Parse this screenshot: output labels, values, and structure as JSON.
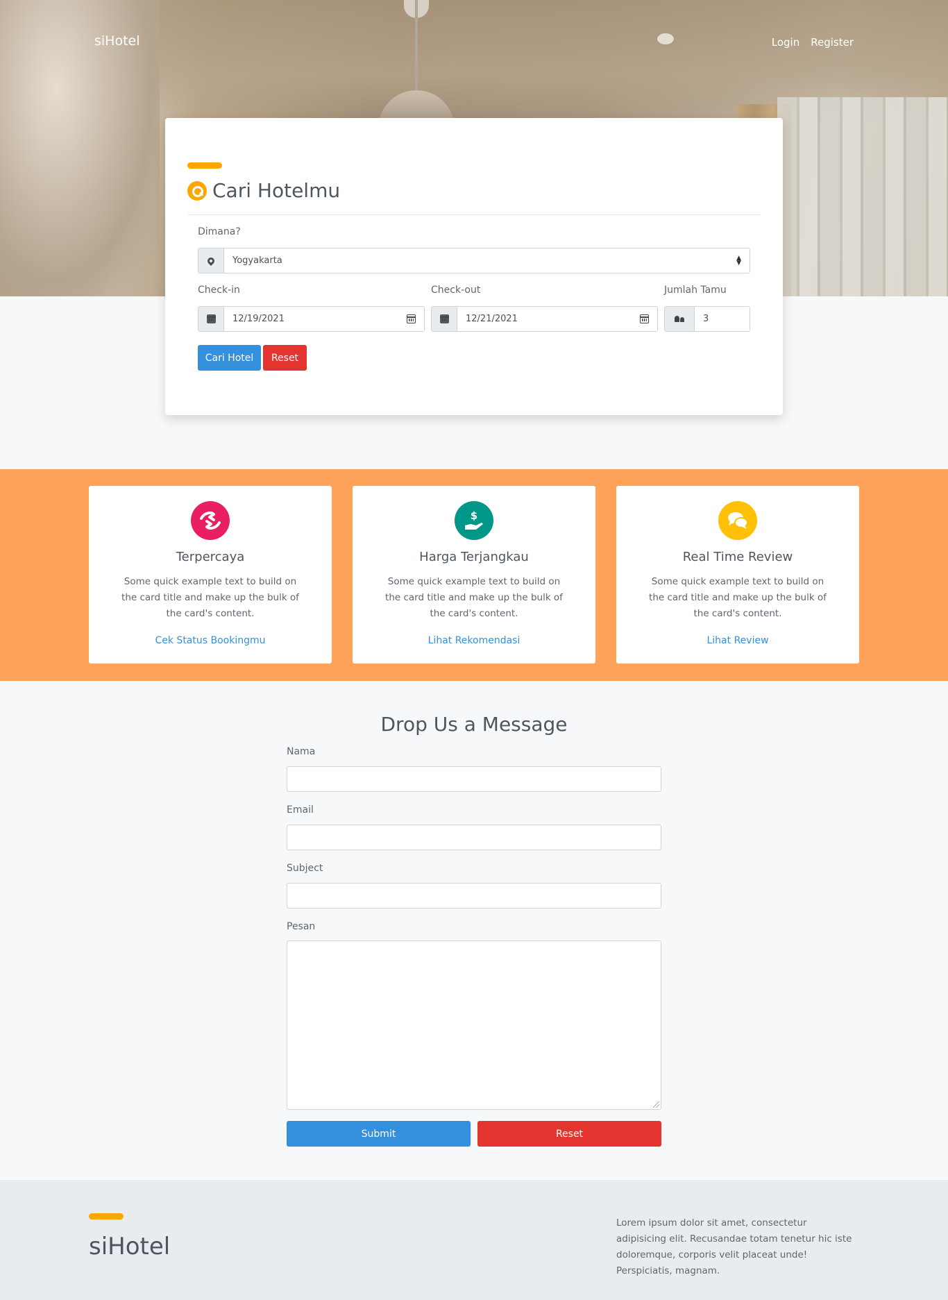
{
  "navbar": {
    "brand": "siHotel",
    "links": [
      "Login",
      "Register"
    ]
  },
  "search": {
    "title": "Cari Hotelmu",
    "location_label": "Dimana?",
    "location_value": "Yogyakarta",
    "checkin_label": "Check-in",
    "checkin_value": "12/19/2021",
    "checkout_label": "Check-out",
    "checkout_value": "12/21/2021",
    "guests_label": "Jumlah Tamu",
    "guests_value": "3",
    "search_button": "Cari Hotel",
    "reset_button": "Reset"
  },
  "features": [
    {
      "icon": "handshake-icon",
      "color": "#e91e63",
      "title": "Terpercaya",
      "text": "Some quick example text to build on the card title and make up the bulk of the card's content.",
      "link": "Cek Status Bookingmu"
    },
    {
      "icon": "dollar-hand-icon",
      "color": "#009688",
      "title": "Harga Terjangkau",
      "text": "Some quick example text to build on the card title and make up the bulk of the card's content.",
      "link": "Lihat Rekomendasi"
    },
    {
      "icon": "comments-icon",
      "color": "#ffc107",
      "title": "Real Time Review",
      "text": "Some quick example text to build on the card title and make up the bulk of the card's content.",
      "link": "Lihat Review"
    }
  ],
  "contact": {
    "title": "Drop Us a Message",
    "name_label": "Nama",
    "email_label": "Email",
    "subject_label": "Subject",
    "message_label": "Pesan",
    "submit_button": "Submit",
    "reset_button": "Reset"
  },
  "footer": {
    "brand": "siHotel",
    "text": "Lorem ipsum dolor sit amet, consectetur adipisicing elit. Recusandae totam tenetur hic iste doloremque, corporis velit placeat unde! Perspiciatis, magnam."
  },
  "colors": {
    "accent": "#fca600",
    "primary": "#3490dc",
    "danger": "#e3342f",
    "features_band": "#ffa25a"
  }
}
